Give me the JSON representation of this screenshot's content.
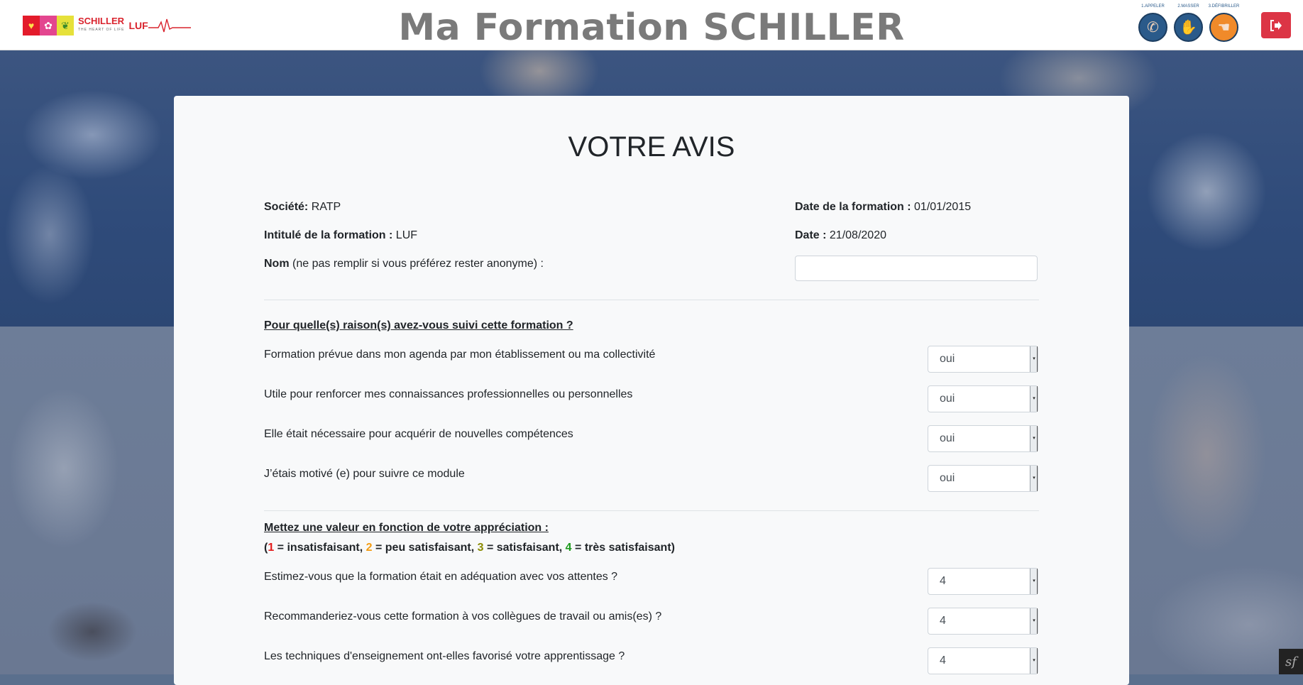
{
  "header": {
    "site_title": "Ma Formation SCHILLER",
    "logo_text": "SCHILLER",
    "logo_subtext": "THE HEART OF LIFE",
    "logo_luf": "LUF",
    "steps": [
      {
        "label": "1.APPELER",
        "icon": "phone-hand-icon"
      },
      {
        "label": "2.MASSER",
        "icon": "hand-icon"
      },
      {
        "label": "3.DÉFIBRILLER",
        "icon": "defibrillator-hand-icon"
      }
    ],
    "logout_icon": "sign-out-icon"
  },
  "form": {
    "title": "VOTRE AVIS",
    "company_label": "Société:",
    "company_value": "RATP",
    "training_date_label": "Date de la formation :",
    "training_date_value": "01/01/2015",
    "training_name_label": "Intitulé de la formation :",
    "training_name_value": "LUF",
    "date_label": "Date :",
    "date_value": "21/08/2020",
    "name_label": "Nom",
    "name_hint": "(ne pas remplir si vous préférez rester anonyme) :",
    "name_value": "",
    "section1_title": "Pour quelle(s) raison(s) avez-vous suivi cette formation ?",
    "section1_questions": [
      {
        "label": "Formation prévue dans mon agenda par mon établissement ou ma collectivité",
        "value": "oui"
      },
      {
        "label": "Utile pour renforcer mes connaissances professionnelles ou personnelles",
        "value": "oui"
      },
      {
        "label": "Elle était nécessaire pour acquérir de nouvelles compétences",
        "value": "oui"
      },
      {
        "label": "J’étais motivé (e) pour suivre ce module",
        "value": "oui"
      }
    ],
    "section2_title": "Mettez une valeur en fonction de votre appréciation :",
    "legend": {
      "open": "(",
      "n1": "1",
      "t1": " = insatisfaisant, ",
      "n2": "2",
      "t2": " = peu satisfaisant, ",
      "n3": "3",
      "t3": " = satisfaisant, ",
      "n4": "4",
      "t4": " = très satisfaisant)"
    },
    "section2_questions": [
      {
        "label": "Estimez-vous que la formation était en adéquation avec vos attentes ?",
        "value": "4"
      },
      {
        "label": "Recommanderiez-vous cette formation à vos collègues de travail ou amis(es) ?",
        "value": "4"
      },
      {
        "label": "Les techniques d'enseignement ont-elles favorisé votre apprentissage ?",
        "value": "4"
      }
    ]
  },
  "colors": {
    "header_title": "#7a7a7a",
    "logout_button": "#dc3545",
    "legend_1": "#e31b1b",
    "legend_2": "#f39c12",
    "legend_3": "#8a8a00",
    "legend_4": "#1e9a1e"
  }
}
